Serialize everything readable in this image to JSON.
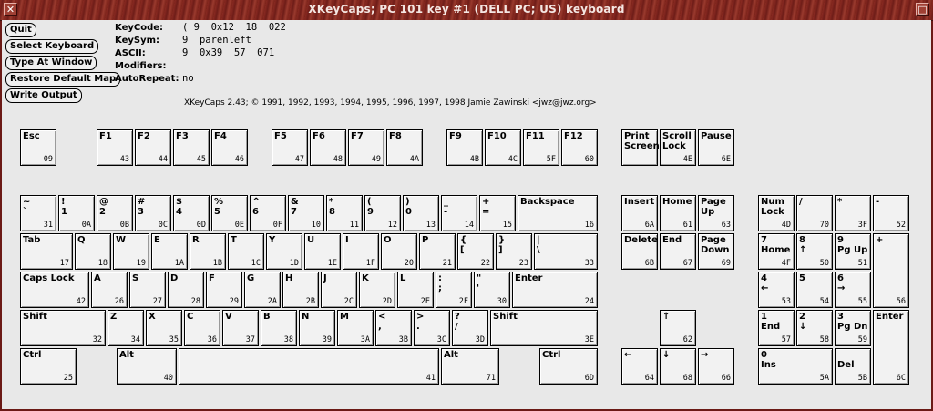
{
  "window": {
    "title": "XKeyCaps; PC 101 key #1 (DELL PC; US) keyboard",
    "close_glyph": "✕",
    "min_glyph": "□"
  },
  "buttons": [
    "Quit",
    "Select Keyboard",
    "Type At Window",
    "Restore Default Map",
    "Write Output"
  ],
  "info": [
    {
      "label": "KeyCode:",
      "value": "( 9  0x12  18  022"
    },
    {
      "label": "KeySym:",
      "value": "9  parenleft"
    },
    {
      "label": "ASCII:",
      "value": "9  0x39  57  071"
    },
    {
      "label": "Modifiers:",
      "value": ""
    },
    {
      "label": "AutoRepeat:",
      "value": "no"
    }
  ],
  "credit": "XKeyCaps 2.43; © 1991, 1992, 1993, 1994, 1995, 1996, 1997, 1998 Jamie Zawinski <jwz@jwz.org>",
  "keys": [
    {
      "l": "Esc",
      "c": "09"
    },
    {
      "l": "F1",
      "c": "43"
    },
    {
      "l": "F2",
      "c": "44"
    },
    {
      "l": "F3",
      "c": "45"
    },
    {
      "l": "F4",
      "c": "46"
    },
    {
      "l": "F5",
      "c": "47"
    },
    {
      "l": "F6",
      "c": "48"
    },
    {
      "l": "F7",
      "c": "49"
    },
    {
      "l": "F8",
      "c": "4A"
    },
    {
      "l": "F9",
      "c": "4B"
    },
    {
      "l": "F10",
      "c": "4C"
    },
    {
      "l": "F11",
      "c": "5F"
    },
    {
      "l": "F12",
      "c": "60"
    },
    {
      "l": "Print\nScreen",
      "c": ""
    },
    {
      "l": "Scroll\nLock",
      "c": "4E"
    },
    {
      "l": "Pause",
      "c": "6E"
    },
    {
      "l": "~\n`",
      "c": "31"
    },
    {
      "l": "!\n1",
      "c": "0A"
    },
    {
      "l": "@\n2",
      "c": "0B"
    },
    {
      "l": "#\n3",
      "c": "0C"
    },
    {
      "l": "$\n4",
      "c": "0D"
    },
    {
      "l": "%\n5",
      "c": "0E"
    },
    {
      "l": "^\n6",
      "c": "0F"
    },
    {
      "l": "&\n7",
      "c": "10"
    },
    {
      "l": "*\n8",
      "c": "11"
    },
    {
      "l": "(\n9",
      "c": "12"
    },
    {
      "l": ")\n0",
      "c": "13"
    },
    {
      "l": "_\n-",
      "c": "14"
    },
    {
      "l": "+\n=",
      "c": "15"
    },
    {
      "l": "Backspace",
      "c": "16"
    },
    {
      "l": "Insert",
      "c": "6A"
    },
    {
      "l": "Home",
      "c": "61"
    },
    {
      "l": "Page\nUp",
      "c": "63"
    },
    {
      "l": "Num\nLock",
      "c": "4D"
    },
    {
      "l": "/",
      "c": "70"
    },
    {
      "l": "*",
      "c": "3F"
    },
    {
      "l": "-",
      "c": "52"
    },
    {
      "l": "Tab",
      "c": "17"
    },
    {
      "l": "Q",
      "c": "18"
    },
    {
      "l": "W",
      "c": "19"
    },
    {
      "l": "E",
      "c": "1A"
    },
    {
      "l": "R",
      "c": "1B"
    },
    {
      "l": "T",
      "c": "1C"
    },
    {
      "l": "Y",
      "c": "1D"
    },
    {
      "l": "U",
      "c": "1E"
    },
    {
      "l": "I",
      "c": "1F"
    },
    {
      "l": "O",
      "c": "20"
    },
    {
      "l": "P",
      "c": "21"
    },
    {
      "l": "{\n[",
      "c": "22"
    },
    {
      "l": "}\n]",
      "c": "23"
    },
    {
      "l": "|\n\\",
      "c": "33"
    },
    {
      "l": "Delete",
      "c": "6B"
    },
    {
      "l": "End",
      "c": "67"
    },
    {
      "l": "Page\nDown",
      "c": "69"
    },
    {
      "l": "7\nHome",
      "c": "4F"
    },
    {
      "l": "8\n↑",
      "c": "50"
    },
    {
      "l": "9\nPg Up",
      "c": "51"
    },
    {
      "l": "+",
      "c": "56"
    },
    {
      "l": "Caps Lock",
      "c": "42"
    },
    {
      "l": "A",
      "c": "26"
    },
    {
      "l": "S",
      "c": "27"
    },
    {
      "l": "D",
      "c": "28"
    },
    {
      "l": "F",
      "c": "29"
    },
    {
      "l": "G",
      "c": "2A"
    },
    {
      "l": "H",
      "c": "2B"
    },
    {
      "l": "J",
      "c": "2C"
    },
    {
      "l": "K",
      "c": "2D"
    },
    {
      "l": "L",
      "c": "2E"
    },
    {
      "l": ":\n;",
      "c": "2F"
    },
    {
      "l": "\"\n'",
      "c": "30"
    },
    {
      "l": "Enter",
      "c": "24"
    },
    {
      "l": "4\n←",
      "c": "53"
    },
    {
      "l": "5",
      "c": "54"
    },
    {
      "l": "6\n→",
      "c": "55"
    },
    {
      "l": "Shift",
      "c": "32"
    },
    {
      "l": "Z",
      "c": "34"
    },
    {
      "l": "X",
      "c": "35"
    },
    {
      "l": "C",
      "c": "36"
    },
    {
      "l": "V",
      "c": "37"
    },
    {
      "l": "B",
      "c": "38"
    },
    {
      "l": "N",
      "c": "39"
    },
    {
      "l": "M",
      "c": "3A"
    },
    {
      "l": "<\n,",
      "c": "3B"
    },
    {
      "l": ">\n.",
      "c": "3C"
    },
    {
      "l": "?\n/",
      "c": "3D"
    },
    {
      "l": "Shift",
      "c": "3E"
    },
    {
      "l": "↑",
      "c": "62"
    },
    {
      "l": "1\nEnd",
      "c": "57"
    },
    {
      "l": "2\n↓",
      "c": "58"
    },
    {
      "l": "3\nPg Dn",
      "c": "59"
    },
    {
      "l": "Enter",
      "c": "6C"
    },
    {
      "l": "Ctrl",
      "c": "25"
    },
    {
      "l": "Alt",
      "c": "40"
    },
    {
      "l": "",
      "c": "41"
    },
    {
      "l": "Alt",
      "c": "71"
    },
    {
      "l": "Ctrl",
      "c": "6D"
    },
    {
      "l": "←",
      "c": "64"
    },
    {
      "l": "↓",
      "c": "68"
    },
    {
      "l": "→",
      "c": "66"
    },
    {
      "l": "0\nIns",
      "c": "5A"
    },
    {
      "l": "\nDel",
      "c": "5B"
    }
  ]
}
